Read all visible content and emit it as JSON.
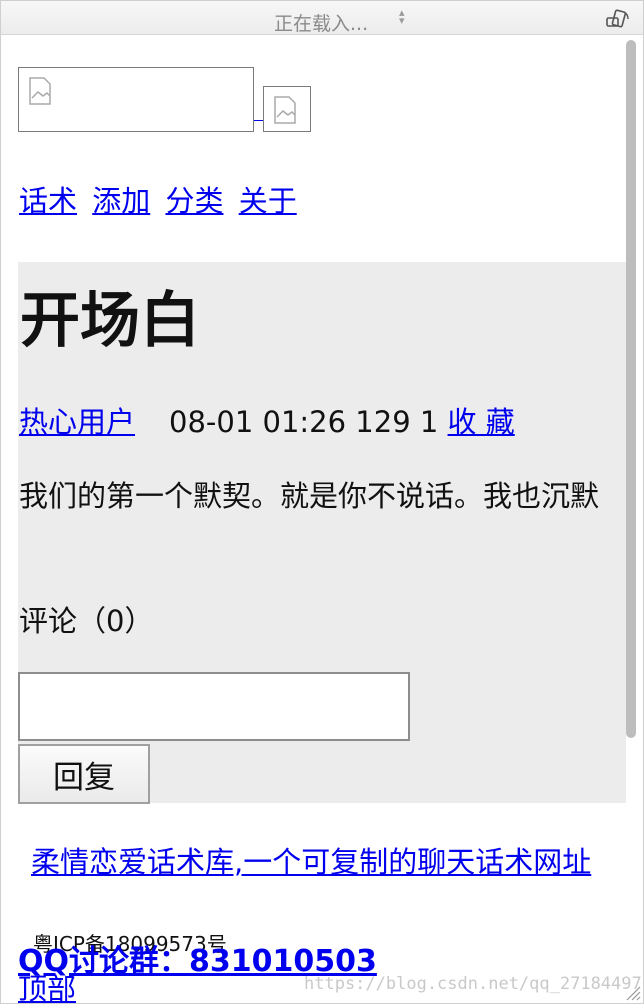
{
  "browser": {
    "loading_title": "正在载入..."
  },
  "header": {
    "logo_alt": "",
    "nav": [
      "话术",
      "添加",
      "分类",
      "关于"
    ]
  },
  "post": {
    "title": "开场白",
    "author": "热心用户",
    "meta_text": "08-01 01:26 129 1",
    "favorite_label": "收 藏",
    "content": "我们的第一个默契。就是你不说话。我也沉默",
    "comments_label": "评论（0）",
    "reply_value": "",
    "reply_button_label": "回复"
  },
  "footer": {
    "site_link": "柔情恋爱话术库,一个可复制的聊天话术网址",
    "icp": "粤ICP备18099573号",
    "qq_group": "QQ讨论群：831010503",
    "back_to_top": "顶部",
    "watermark": "https://blog.csdn.net/qq_27184497"
  }
}
